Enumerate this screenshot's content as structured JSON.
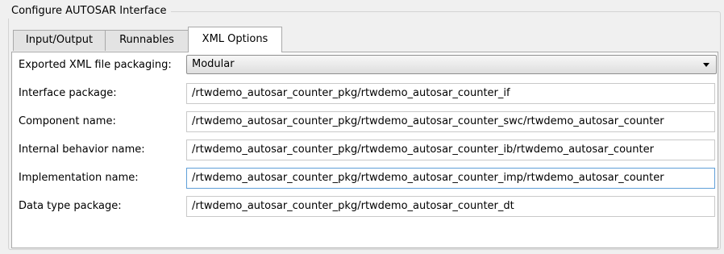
{
  "dialog": {
    "group_title": "Configure AUTOSAR Interface"
  },
  "tabs": [
    {
      "label": "Input/Output",
      "active": false
    },
    {
      "label": "Runnables",
      "active": false
    },
    {
      "label": "XML Options",
      "active": true
    }
  ],
  "xml_options": {
    "packaging": {
      "label": "Exported XML file packaging:",
      "selected": "Modular"
    },
    "fields": [
      {
        "label": "Interface package:",
        "value": "/rtwdemo_autosar_counter_pkg/rtwdemo_autosar_counter_if"
      },
      {
        "label": "Component name:",
        "value": "/rtwdemo_autosar_counter_pkg/rtwdemo_autosar_counter_swc/rtwdemo_autosar_counter"
      },
      {
        "label": "Internal behavior name:",
        "value": "/rtwdemo_autosar_counter_pkg/rtwdemo_autosar_counter_ib/rtwdemo_autosar_counter"
      },
      {
        "label": "Implementation name:",
        "value": "/rtwdemo_autosar_counter_pkg/rtwdemo_autosar_counter_imp/rtwdemo_autosar_counter"
      },
      {
        "label": "Data type package:",
        "value": "/rtwdemo_autosar_counter_pkg/rtwdemo_autosar_counter_dt"
      }
    ]
  }
}
